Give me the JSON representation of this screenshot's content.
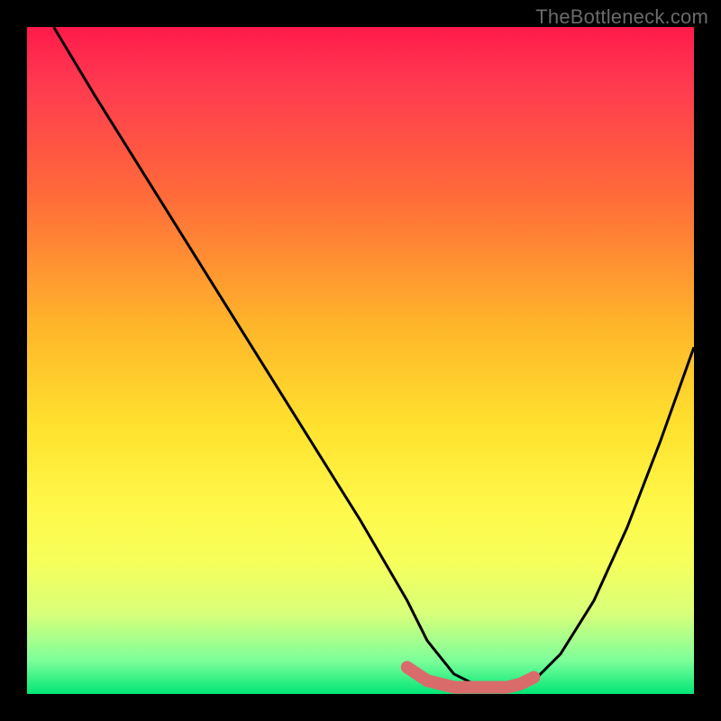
{
  "watermark": "TheBottleneck.com",
  "chart_data": {
    "type": "line",
    "title": "",
    "xlabel": "",
    "ylabel": "",
    "xlim": [
      0,
      100
    ],
    "ylim": [
      0,
      100
    ],
    "series": [
      {
        "name": "curve",
        "x": [
          4,
          10,
          20,
          30,
          40,
          50,
          57,
          60,
          64,
          68,
          72,
          74,
          76,
          80,
          85,
          90,
          95,
          100
        ],
        "values": [
          100,
          90,
          74,
          58,
          42,
          26,
          14,
          8,
          3,
          1,
          1,
          1,
          2,
          6,
          14,
          25,
          38,
          52
        ]
      }
    ],
    "highlight_segment": {
      "name": "bottom-flat-highlight",
      "description": "thick pink segment along the curve bottom",
      "x": [
        57,
        60,
        64,
        68,
        72,
        74,
        76
      ],
      "values": [
        4,
        2,
        1,
        1,
        1,
        1.5,
        2.5
      ],
      "color": "#d96b6b"
    },
    "background": {
      "type": "vertical-gradient",
      "stops": [
        {
          "pos": 0.0,
          "color": "#ff1a4a"
        },
        {
          "pos": 0.45,
          "color": "#ffb62a"
        },
        {
          "pos": 0.72,
          "color": "#fff84a"
        },
        {
          "pos": 1.0,
          "color": "#00e676"
        }
      ]
    }
  }
}
